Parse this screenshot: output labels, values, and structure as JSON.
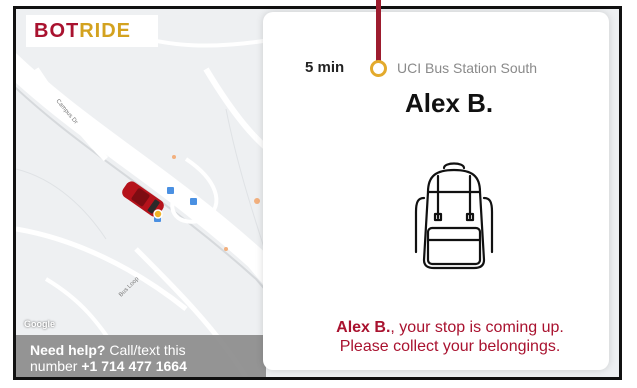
{
  "brand": {
    "part1": "Bot",
    "part2": "Ride",
    "colors": {
      "primary": "#a9122f",
      "accent": "#d3a21f"
    }
  },
  "map": {
    "attribution": "Google",
    "street_labels": [
      "Campus Dr",
      "Bus Loop"
    ]
  },
  "help": {
    "bold": "Need help?",
    "text1": "Call/text this",
    "text2": "number",
    "phone": "+1 714 477 1664"
  },
  "trip": {
    "eta": "5 min",
    "stop": "UCI Bus Station South",
    "passenger": "Alex B.",
    "message_name": "Alex B.",
    "message_line1": ", your stop is coming up.",
    "message_line2": "Please collect your belongings."
  },
  "icons": [
    "backpack-icon",
    "vehicle-marker-icon",
    "bus-stop-icon"
  ]
}
